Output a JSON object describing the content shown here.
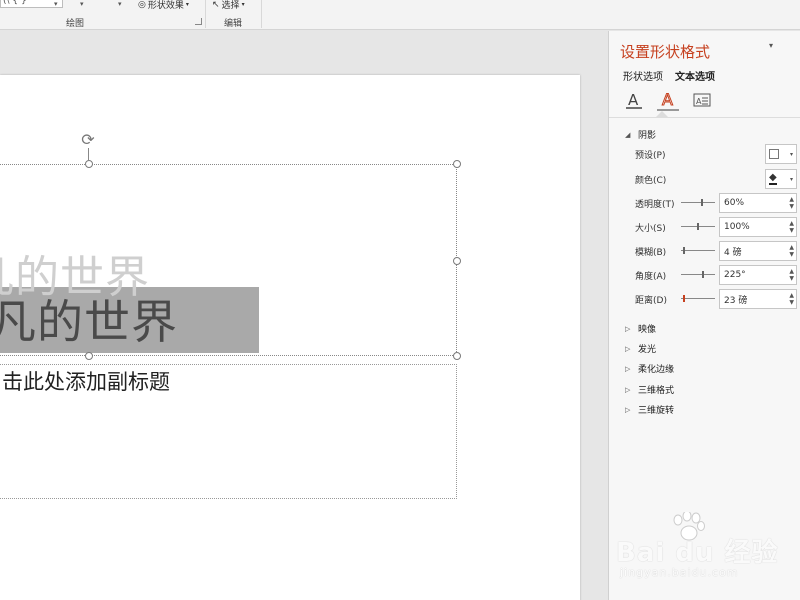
{
  "ribbon": {
    "drawing_group_label": "绘图",
    "shape_effects_label": "形状效果",
    "select_label": "选择",
    "edit_group_label": "编辑"
  },
  "slide": {
    "title_text": "凡的世界",
    "title_shadow_text": "凡的世界",
    "subtitle_placeholder": "击此处添加副标题"
  },
  "panel": {
    "title": "设置形状格式",
    "tabs": [
      {
        "label": "形状选项",
        "active": false
      },
      {
        "label": "文本选项",
        "active": true
      }
    ],
    "icons": [
      "text-fill-icon",
      "text-effects-icon",
      "textbox-icon"
    ],
    "shadow_section": {
      "label": "阴影",
      "preset_label": "预设(P)",
      "color_label": "颜色(C)",
      "rows": [
        {
          "label": "透明度(T)",
          "value": "60%"
        },
        {
          "label": "大小(S)",
          "value": "100%"
        },
        {
          "label": "模糊(B)",
          "value": "4 磅"
        },
        {
          "label": "角度(A)",
          "value": "225°"
        },
        {
          "label": "距离(D)",
          "value": "23 磅"
        }
      ]
    },
    "collapsed_sections": [
      "映像",
      "发光",
      "柔化边缘",
      "三维格式",
      "三维旋转"
    ]
  },
  "watermark": {
    "logo": "Bai du 经验",
    "sub": "jingyan.baidu.com"
  },
  "colors": {
    "accent": "#c6401f",
    "title_highlight": "#a9a9a9"
  }
}
